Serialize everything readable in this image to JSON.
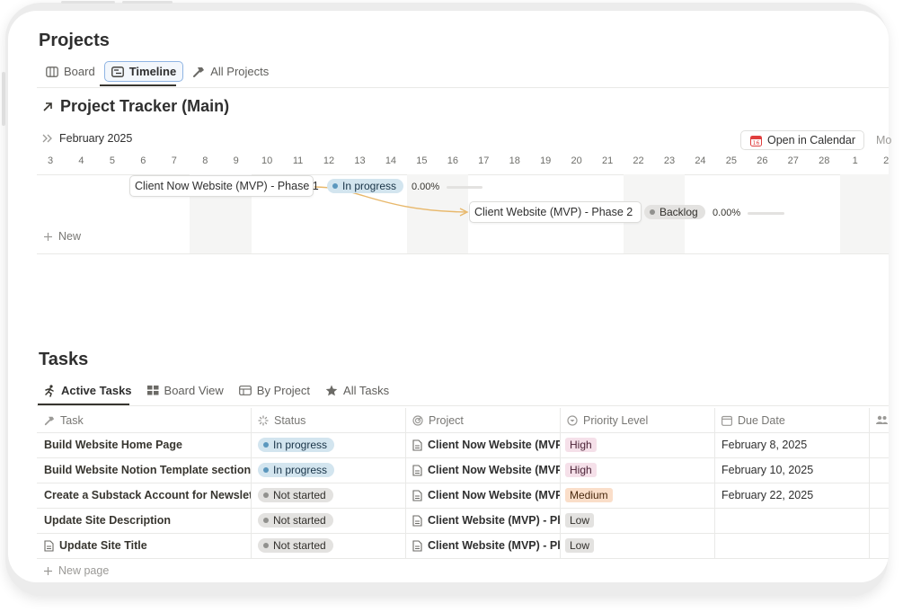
{
  "projects": {
    "title": "Projects",
    "views": [
      {
        "label": "Board",
        "icon": "board-columns-icon"
      },
      {
        "label": "Timeline",
        "icon": "timeline-icon",
        "active": true
      },
      {
        "label": "All Projects",
        "icon": "hammer-icon"
      }
    ],
    "database_title": "Project Tracker (Main)",
    "timeline": {
      "month": "February 2025",
      "open_calendar_label": "Open in Calendar",
      "more_label": "Mo",
      "days": [
        "3",
        "4",
        "5",
        "6",
        "7",
        "8",
        "9",
        "10",
        "11",
        "12",
        "13",
        "14",
        "15",
        "16",
        "17",
        "18",
        "19",
        "20",
        "21",
        "22",
        "23",
        "24",
        "25",
        "26",
        "27",
        "28",
        "1",
        "2"
      ],
      "new_label": "New",
      "items": [
        {
          "name": "Client Now Website (MVP) - Phase 1",
          "status": "In progress",
          "progress": "0.00%"
        },
        {
          "name": "Client Website (MVP) - Phase 2",
          "status": "Backlog",
          "progress": "0.00%"
        }
      ]
    }
  },
  "tasks": {
    "title": "Tasks",
    "views": [
      {
        "label": "Active Tasks",
        "icon": "running-person-icon",
        "active": true
      },
      {
        "label": "Board View",
        "icon": "board-grid-icon"
      },
      {
        "label": "By Project",
        "icon": "table-icon"
      },
      {
        "label": "All Tasks",
        "icon": "star-icon"
      }
    ],
    "columns": [
      "Task",
      "Status",
      "Project",
      "Priority Level",
      "Due Date"
    ],
    "rows": [
      {
        "task": "Build Website Home Page",
        "status": "In progress",
        "project": "Client Now Website (MVP",
        "priority": "High",
        "due": "February 8, 2025"
      },
      {
        "task": "Build Website Notion Template section",
        "status": "In progress",
        "project": "Client Now Website (MVP",
        "priority": "High",
        "due": "February 10, 2025"
      },
      {
        "task": "Create a Substack Account for Newslette",
        "status": "Not started",
        "project": "Client Now Website (MVP",
        "priority": "Medium",
        "due": "February 22, 2025"
      },
      {
        "task": "Update Site Description",
        "status": "Not started",
        "project": "Client Website (MVP) - Ph",
        "priority": "Low",
        "due": ""
      },
      {
        "task": "Update Site Title",
        "status": "Not started",
        "project": "Client Website (MVP) - Ph",
        "priority": "Low",
        "due": ""
      }
    ],
    "new_page_label": "New page"
  },
  "colors": {
    "in_progress_bg": "#d3e5ef",
    "not_started_bg": "#e3e2e0",
    "high_bg": "#f5e0e9",
    "medium_bg": "#fadec9",
    "low_bg": "#e3e2e0",
    "dependency_line": "#e8b86b",
    "active_view_border": "#8fb4e3"
  }
}
